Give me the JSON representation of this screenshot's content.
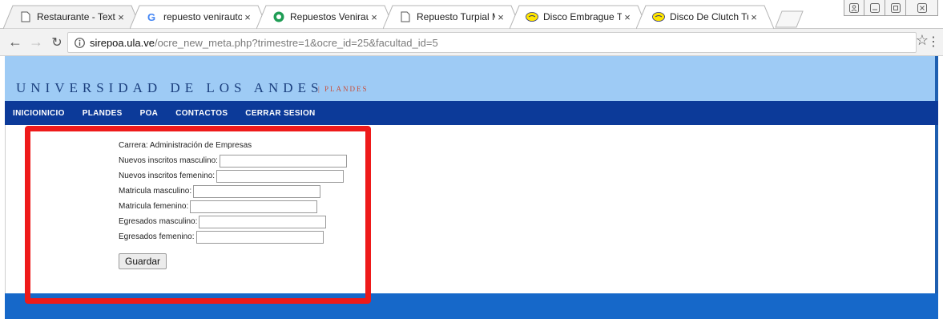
{
  "browser": {
    "tabs": [
      {
        "title": "Restaurante - Texto",
        "icon": "page-icon",
        "active": true
      },
      {
        "title": "repuesto venirauto turp",
        "icon": "google-icon",
        "active": false
      },
      {
        "title": "Repuestos Venirauto C",
        "icon": "site-green-icon",
        "active": false
      },
      {
        "title": "Repuesto Turpial Mara",
        "icon": "page-icon",
        "active": false
      },
      {
        "title": "Disco Embrague Turpia",
        "icon": "mercadolibre-icon",
        "active": false
      },
      {
        "title": "Disco De Clutch Turpia",
        "icon": "mercadolibre-icon",
        "active": false
      }
    ],
    "close_glyph": "×",
    "url_host": "sirepoa.ula.ve",
    "url_path": "/ocre_new_meta.php?trimestre=1&ocre_id=25&facultad_id=5"
  },
  "site": {
    "title": "UNIVERSIDAD DE LOS ANDES",
    "subtitle": "| PLANDES",
    "nav": [
      "INICIOINICIO",
      "PLANDES",
      "POA",
      "CONTACTOS",
      "CERRAR SESION"
    ]
  },
  "form": {
    "carrera": "Carrera: Administración de Empresas",
    "fields": [
      {
        "label": "Nuevos inscritos masculino:",
        "value": ""
      },
      {
        "label": "Nuevos inscritos femenino:",
        "value": ""
      },
      {
        "label": "Matricula masculino:",
        "value": ""
      },
      {
        "label": "Matricula femenino:",
        "value": ""
      },
      {
        "label": "Egresados masculino:",
        "value": ""
      },
      {
        "label": "Egresados femenino:",
        "value": ""
      }
    ],
    "submit": "Guardar"
  },
  "colors": {
    "banner": "#9ecbf5",
    "navbar": "#0c3a99",
    "footer": "#1668c9",
    "highlight": "#ee1a1a"
  }
}
